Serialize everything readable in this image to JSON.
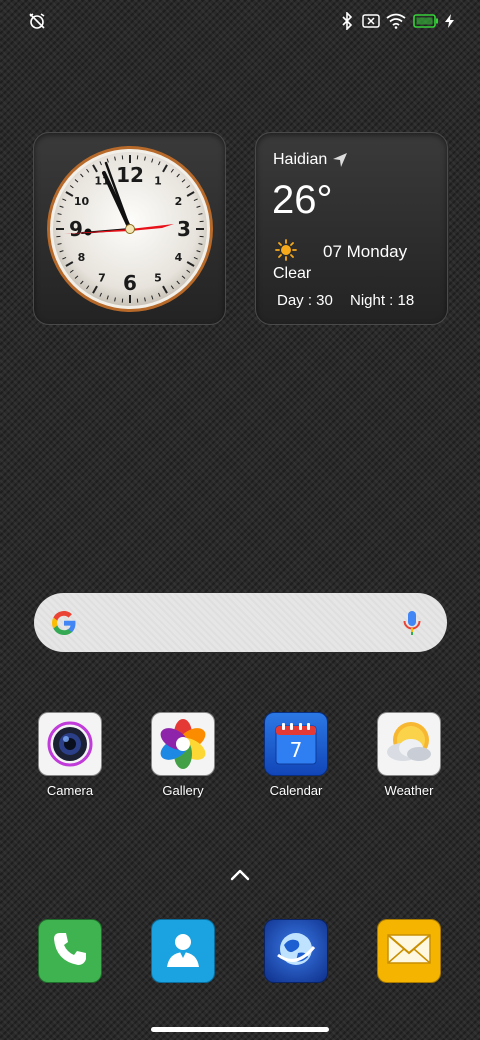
{
  "status_bar": {
    "left_icons": [
      "alarm-off-icon"
    ],
    "right_icons": [
      "bluetooth-icon",
      "no-sim-icon",
      "wifi-icon",
      "battery-icon",
      "charging-icon"
    ],
    "battery_color": "#37d13a"
  },
  "clock_widget": {
    "numerals": [
      "12",
      "3",
      "6",
      "9"
    ],
    "minor_numerals": [
      "1",
      "2",
      "4",
      "5",
      "7",
      "8",
      "10",
      "11"
    ],
    "second_hand_color": "#e8121b"
  },
  "weather_widget": {
    "city": "Haidian",
    "temperature": "26°",
    "date": "07 Monday",
    "condition": "Clear",
    "day": "Day : 30",
    "night": "Night : 18",
    "icons": [
      "location-arrow-icon",
      "sun-icon"
    ]
  },
  "search": {
    "icons": [
      "google-logo-icon",
      "microphone-icon"
    ]
  },
  "apps": [
    {
      "label": "Camera",
      "icon": "camera-icon"
    },
    {
      "label": "Gallery",
      "icon": "gallery-icon"
    },
    {
      "label": "Calendar",
      "icon": "calendar-icon",
      "day_number": "7"
    },
    {
      "label": "Weather",
      "icon": "weather-icon"
    }
  ],
  "dock": [
    {
      "icon": "phone-icon",
      "color": "#3fb34f"
    },
    {
      "icon": "contacts-icon",
      "color": "#1aa3e0"
    },
    {
      "icon": "browser-icon",
      "color": "#1a4fb5"
    },
    {
      "icon": "mail-icon",
      "color": "#f4b400"
    }
  ],
  "app_drawer": {
    "icon": "chevron-up-icon"
  }
}
